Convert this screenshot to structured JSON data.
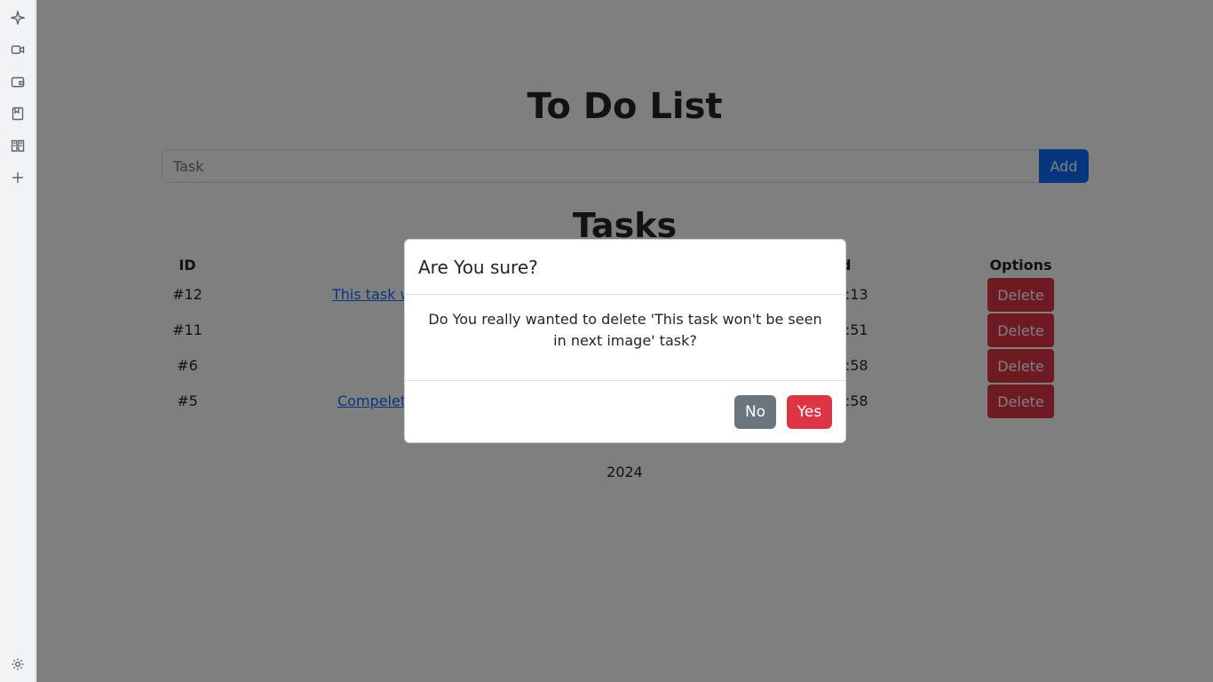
{
  "sidebar": {
    "icons": [
      "sparkle-icon",
      "video-icon",
      "wallet-icon",
      "bookmark-icon",
      "reading-list-icon",
      "plus-icon",
      "gear-icon"
    ]
  },
  "page": {
    "title": "To Do List",
    "input_placeholder": "Task",
    "add_label": "Add",
    "tasks_title": "Tasks",
    "columns": {
      "id": "ID",
      "date": "d",
      "options": "Options"
    },
    "rows": [
      {
        "id": "#12",
        "task": "This task w",
        "date": ": 16:13",
        "delete": "Delete"
      },
      {
        "id": "#11",
        "task": "",
        "date": ": 15:51",
        "delete": "Delete"
      },
      {
        "id": "#6",
        "task": "",
        "date": ": 14:58",
        "delete": "Delete"
      },
      {
        "id": "#5",
        "task": "Compelete",
        "date": ": 14:58",
        "delete": "Delete"
      }
    ],
    "footer": "2024"
  },
  "modal": {
    "title": "Are You sure?",
    "body": "Do You really wanted to delete 'This task won't be seen in next image' task?",
    "no_label": "No",
    "yes_label": "Yes"
  },
  "colors": {
    "primary": "#0d6efd",
    "danger": "#dc3545",
    "secondary": "#6c757d"
  }
}
